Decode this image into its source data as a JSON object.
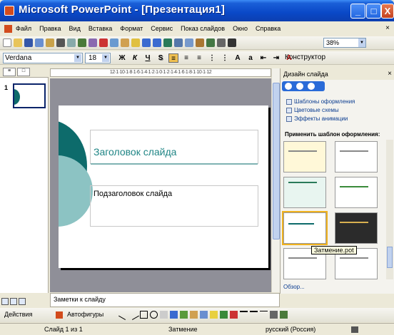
{
  "window": {
    "title": "Microsoft PowerPoint - [Презентация1]",
    "min_label": "_",
    "max_label": "□",
    "close_label": "X"
  },
  "menu": {
    "items": [
      "Файл",
      "Правка",
      "Вид",
      "Вставка",
      "Формат",
      "Сервис",
      "Показ слайдов",
      "Окно",
      "Справка"
    ],
    "close_doc": "×"
  },
  "standard_toolbar": {
    "zoom": "38%"
  },
  "format_toolbar": {
    "font": "Verdana",
    "size": "18",
    "bold": "Ж",
    "italic": "К",
    "underline": "Ч",
    "shadow": "S",
    "constructor": "Конструктор"
  },
  "left_pane": {
    "slide_number": "1"
  },
  "ruler": {
    "text": "12·1·10·1·8·1·6·1·4·1·2·1·0·1·2·1·4·1·6·1·8·1·10·1·12"
  },
  "slide": {
    "title": "Заголовок слайда",
    "subtitle": "Подзаголовок слайда"
  },
  "task_pane": {
    "title": "Дизайн слайда",
    "close": "×",
    "links": [
      "Шаблоны оформления",
      "Цветовые схемы",
      "Эффекты анимации"
    ],
    "apply_label": "Применить шаблон оформления:",
    "tooltip": "Затмение.pot",
    "browse": "Обзор..."
  },
  "notes": {
    "placeholder": "Заметки к слайду"
  },
  "drawing_toolbar": {
    "actions": "Действия",
    "autoshapes": "Автофигуры"
  },
  "status": {
    "slide": "Слайд 1 из 1",
    "design": "Затмение",
    "language": "русский (Россия)"
  },
  "colors": {
    "accent_teal": "#0d6b6b",
    "title_text": "#1f8585",
    "titlebar": "#0a48c7"
  }
}
